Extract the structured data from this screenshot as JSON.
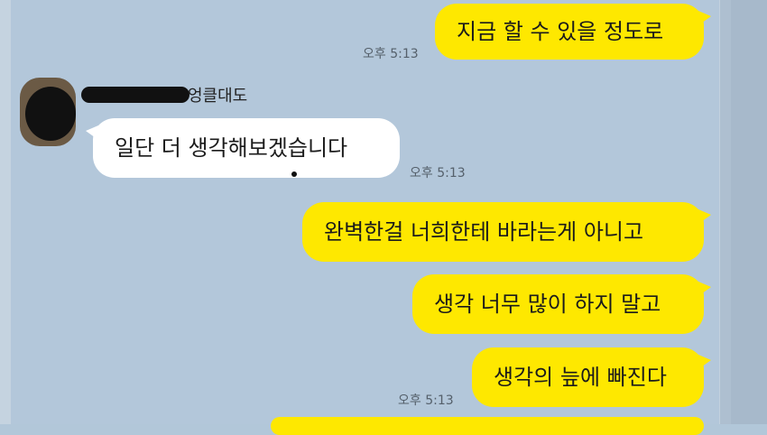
{
  "chat": {
    "sender_name": "엉클대도",
    "messages": [
      {
        "side": "me",
        "text": "지금 할 수 있을 정도로",
        "time": "오후 5:13"
      },
      {
        "side": "other",
        "text": "일단 더 생각해보겠습니다",
        "time": "오후 5:13"
      },
      {
        "side": "me",
        "text": "완벽한걸 너희한테 바라는게 아니고"
      },
      {
        "side": "me",
        "text": "생각 너무 많이 하지 말고"
      },
      {
        "side": "me",
        "text": "생각의 늪에 빠진다",
        "time": "오후 5:13"
      }
    ]
  },
  "colors": {
    "background": "#b2c7d9",
    "my_bubble": "#fee800",
    "their_bubble": "#ffffff"
  },
  "icons": {
    "avatar": "profile-avatar"
  }
}
